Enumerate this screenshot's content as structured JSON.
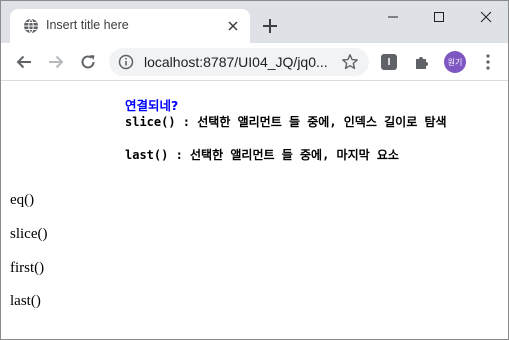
{
  "browser": {
    "tab_title": "Insert title here",
    "url": "localhost:8787/UI04_JQ/jq0...",
    "extension_label": "I",
    "profile_label": "원기",
    "theme_color": "#dee1e6",
    "avatar_color": "#7e57c2"
  },
  "page": {
    "status": "연결되네?",
    "status_color": "#0000ff",
    "descriptions": [
      "slice() : 선택한 앨리먼트 들 중에, 인덱스 길이로 탐색",
      "last() : 선택한 앨리먼트 들 중에, 마지막 요소"
    ],
    "items": [
      "eq()",
      "slice()",
      "first()",
      "last()"
    ]
  }
}
